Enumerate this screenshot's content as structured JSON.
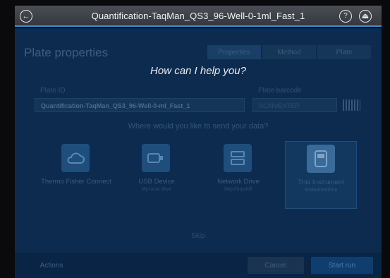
{
  "window": {
    "title": "Quantification-TaqMan_QS3_96-Well-0-1ml_Fast_1",
    "back_icon": "back-arrow-icon",
    "help_icon": "help-icon",
    "help_glyph": "?",
    "eject_icon": "eject-icon"
  },
  "overlay": {
    "prompt": "How can I help you?",
    "skip_label": "Skip"
  },
  "plate": {
    "heading": "Plate properties",
    "tabs": [
      "Properties",
      "Method",
      "Plate"
    ],
    "plate_id_label": "Plate ID",
    "plate_id_value": "Quantification-TaqMan_QS3_96-Well-0-ml_Fast_1",
    "barcode_label": "Plate barcode",
    "barcode_value": "SCAN/ENTER",
    "send_question": "Where would you like to send your data?"
  },
  "destinations": [
    {
      "label": "Thermo Fisher Connect",
      "sub": "",
      "icon": "cloud-icon"
    },
    {
      "label": "USB Device",
      "sub": "My local drive",
      "icon": "usb-icon"
    },
    {
      "label": "Network Drive",
      "sub": "http://myshift",
      "icon": "server-icon"
    },
    {
      "label": "This Instrument",
      "sub": "/instrument/run",
      "icon": "instrument-icon",
      "selected": true
    }
  ],
  "actions": {
    "actions_label": "Actions",
    "cancel_label": "Cancel",
    "start_label": "Start run"
  },
  "colors": {
    "accent": "#3c8fd6",
    "screen_bg": "#0d2b4e",
    "start_button": "#0f5aa0"
  }
}
